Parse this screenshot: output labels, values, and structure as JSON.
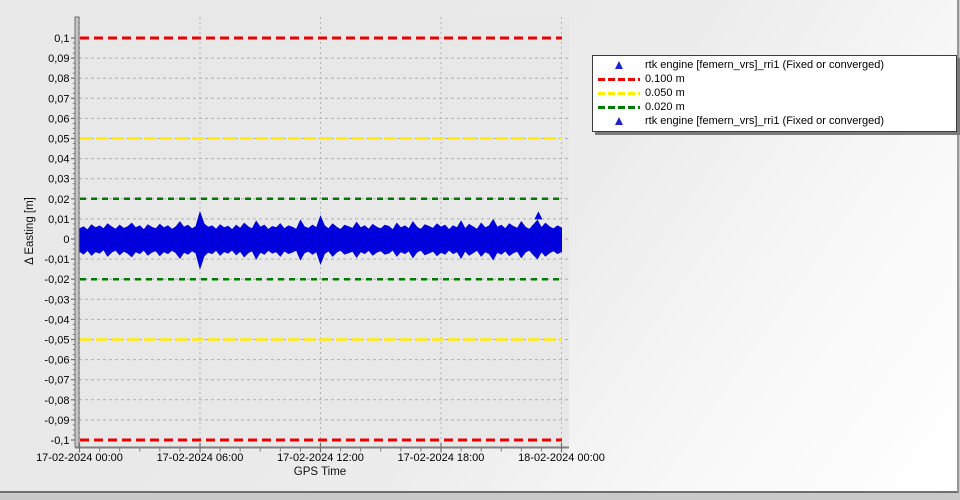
{
  "chart_data": {
    "type": "line",
    "title": "",
    "xlabel": "GPS Time",
    "ylabel": "Δ Easting [m]",
    "ylim": [
      -0.1,
      0.1
    ],
    "grid": true,
    "x_range": {
      "start": "17-02-2024 00:00",
      "end": "18-02-2024 00:00"
    },
    "x_ticks": [
      {
        "f": 0.0,
        "label": "17-02-2024 00:00"
      },
      {
        "f": 0.25,
        "label": "17-02-2024 06:00"
      },
      {
        "f": 0.5,
        "label": "17-02-2024 12:00"
      },
      {
        "f": 0.75,
        "label": "17-02-2024 18:00"
      },
      {
        "f": 1.0,
        "label": "18-02-2024 00:00"
      }
    ],
    "y_ticks": [
      {
        "v": 0.1,
        "label": "0,1"
      },
      {
        "v": 0.09,
        "label": "0,09"
      },
      {
        "v": 0.08,
        "label": "0,08"
      },
      {
        "v": 0.07,
        "label": "0,07"
      },
      {
        "v": 0.06,
        "label": "0,06"
      },
      {
        "v": 0.05,
        "label": "0,05"
      },
      {
        "v": 0.04,
        "label": "0,04"
      },
      {
        "v": 0.03,
        "label": "0,03"
      },
      {
        "v": 0.02,
        "label": "0,02"
      },
      {
        "v": 0.01,
        "label": "0,01"
      },
      {
        "v": 0.0,
        "label": "0"
      },
      {
        "v": -0.01,
        "label": "-0,01"
      },
      {
        "v": -0.02,
        "label": "-0,02"
      },
      {
        "v": -0.03,
        "label": "-0,03"
      },
      {
        "v": -0.04,
        "label": "-0,04"
      },
      {
        "v": -0.05,
        "label": "-0,05"
      },
      {
        "v": -0.06,
        "label": "-0,06"
      },
      {
        "v": -0.07,
        "label": "-0,07"
      },
      {
        "v": -0.08,
        "label": "-0,08"
      },
      {
        "v": -0.09,
        "label": "-0,09"
      },
      {
        "v": -0.1,
        "label": "-0,1"
      }
    ],
    "thresholds": [
      {
        "value": 0.1,
        "color": "#ee0000",
        "width": 3,
        "dash": "9,5"
      },
      {
        "value": -0.1,
        "color": "#ee0000",
        "width": 3,
        "dash": "9,5"
      },
      {
        "value": 0.05,
        "color": "#ffee00",
        "width": 2.5,
        "dash": "12,4"
      },
      {
        "value": -0.05,
        "color": "#ffee00",
        "width": 2.5,
        "dash": "12,4"
      },
      {
        "value": 0.02,
        "color": "#007a00",
        "width": 2.5,
        "dash": "6,5"
      },
      {
        "value": -0.02,
        "color": "#007a00",
        "width": 2.5,
        "dash": "6,5"
      }
    ],
    "series": [
      {
        "name": "rtk engine [femern_vrs]_rri1 (Fixed or converged)",
        "color": "#0000dd",
        "marker": "triangle",
        "note": "dense noise band around 0 m; envelope sampled evenly from 00:00 to 24:00",
        "upper": [
          0.005,
          0.006,
          0.0045,
          0.007,
          0.0055,
          0.0065,
          0.005,
          0.0075,
          0.006,
          0.0048,
          0.0068,
          0.0052,
          0.006,
          0.0078,
          0.0055,
          0.0065,
          0.0045,
          0.007,
          0.0058,
          0.005,
          0.0072,
          0.0055,
          0.0065,
          0.0048,
          0.006,
          0.0085,
          0.0058,
          0.0068,
          0.005,
          0.0062,
          0.0132,
          0.0075,
          0.0058,
          0.0065,
          0.0048,
          0.007,
          0.0055,
          0.0063,
          0.0046,
          0.0068,
          0.0052,
          0.0078,
          0.006,
          0.005,
          0.0088,
          0.0058,
          0.0068,
          0.0047,
          0.0062,
          0.0055,
          0.0075,
          0.005,
          0.0065,
          0.0058,
          0.0048,
          0.0092,
          0.006,
          0.0052,
          0.0068,
          0.0055,
          0.0112,
          0.0065,
          0.005,
          0.0075,
          0.0058,
          0.0047,
          0.0068,
          0.006,
          0.0052,
          0.0082,
          0.0055,
          0.0065,
          0.0048,
          0.0072,
          0.0058,
          0.005,
          0.0068,
          0.0062,
          0.0045,
          0.0078,
          0.0055,
          0.0065,
          0.005,
          0.0085,
          0.0058,
          0.0048,
          0.007,
          0.0062,
          0.0052,
          0.0075,
          0.0058,
          0.0068,
          0.0046,
          0.0065,
          0.0055,
          0.0088,
          0.005,
          0.0072,
          0.006,
          0.0048,
          0.0078,
          0.0055,
          0.0065,
          0.0095,
          0.0058,
          0.0068,
          0.005,
          0.0075,
          0.0062,
          0.0052,
          0.0085,
          0.0058,
          0.0048,
          0.007,
          0.0092,
          0.0055,
          0.0078,
          0.006,
          0.005,
          0.0065,
          0.0055
        ],
        "lower": [
          -0.006,
          -0.0075,
          -0.0055,
          -0.008,
          -0.0062,
          -0.007,
          -0.0052,
          -0.0085,
          -0.0065,
          -0.0055,
          -0.0078,
          -0.006,
          -0.007,
          -0.0088,
          -0.0062,
          -0.0072,
          -0.0054,
          -0.008,
          -0.0065,
          -0.0058,
          -0.0082,
          -0.0062,
          -0.0072,
          -0.0055,
          -0.0068,
          -0.0095,
          -0.0065,
          -0.0075,
          -0.0058,
          -0.007,
          -0.0145,
          -0.0085,
          -0.0065,
          -0.0072,
          -0.0055,
          -0.008,
          -0.0062,
          -0.007,
          -0.0054,
          -0.0078,
          -0.006,
          -0.0088,
          -0.0068,
          -0.0058,
          -0.0098,
          -0.0065,
          -0.0075,
          -0.0055,
          -0.007,
          -0.0062,
          -0.0085,
          -0.0058,
          -0.0072,
          -0.0065,
          -0.0055,
          -0.0102,
          -0.0068,
          -0.006,
          -0.0075,
          -0.0062,
          -0.0122,
          -0.0072,
          -0.0058,
          -0.0085,
          -0.0065,
          -0.0055,
          -0.0075,
          -0.0068,
          -0.006,
          -0.009,
          -0.0062,
          -0.0072,
          -0.0055,
          -0.008,
          -0.0065,
          -0.0058,
          -0.0075,
          -0.007,
          -0.0054,
          -0.0085,
          -0.0062,
          -0.0072,
          -0.0058,
          -0.0092,
          -0.0065,
          -0.0055,
          -0.0078,
          -0.007,
          -0.006,
          -0.0082,
          -0.0065,
          -0.0075,
          -0.0054,
          -0.0072,
          -0.0062,
          -0.0095,
          -0.0058,
          -0.008,
          -0.0068,
          -0.0055,
          -0.0085,
          -0.0062,
          -0.0072,
          -0.0102,
          -0.0065,
          -0.0075,
          -0.0058,
          -0.0082,
          -0.0068,
          -0.006,
          -0.0092,
          -0.0065,
          -0.0055,
          -0.0078,
          -0.0098,
          -0.0062,
          -0.0085,
          -0.0068,
          -0.0058,
          -0.0072,
          -0.0062
        ]
      }
    ],
    "outliers": [
      {
        "x_frac": 0.952,
        "y": 0.0115
      }
    ]
  },
  "axes": {
    "x_title": "GPS Time",
    "y_title": "Δ Easting [m]"
  },
  "legend": {
    "items": [
      {
        "marker": "triangle",
        "color": "#2222cc",
        "label": "rtk engine [femern_vrs]_rri1 (Fixed or converged)"
      },
      {
        "marker": "dashes",
        "color": "#ee0000",
        "label": "0.100 m"
      },
      {
        "marker": "dashes",
        "color": "#ffee00",
        "label": "0.050 m"
      },
      {
        "marker": "dashes",
        "color": "#007a00",
        "label": "0.020 m"
      },
      {
        "marker": "triangle",
        "color": "#2222cc",
        "label": "rtk engine [femern_vrs]_rri1 (Fixed or converged)"
      }
    ]
  },
  "colors": {
    "plot_bg": "#e8e8e8",
    "grid": "#aeaeae",
    "axis": "#787878",
    "data_blue": "#0000dd"
  }
}
